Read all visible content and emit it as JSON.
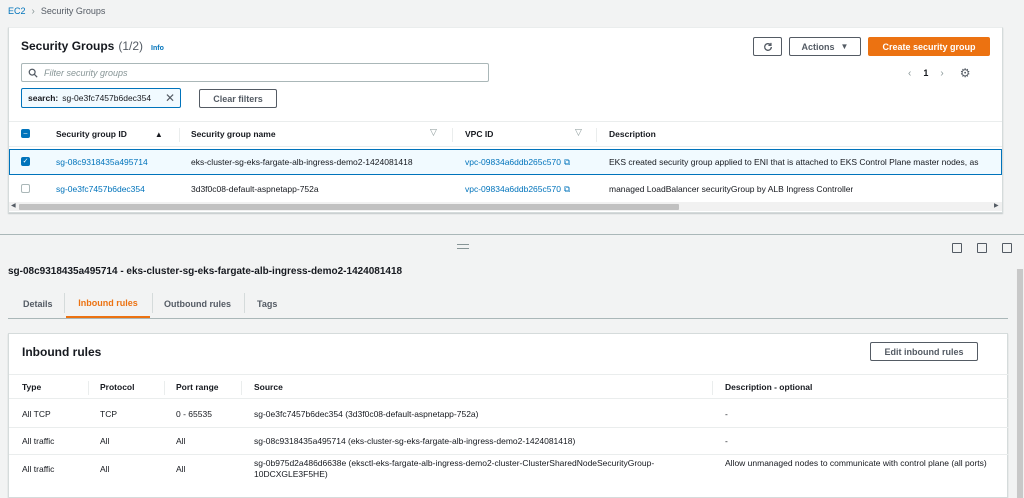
{
  "breadcrumb": {
    "root": "EC2",
    "current": "Security Groups"
  },
  "list": {
    "title": "Security Groups",
    "count": "(1/2)",
    "info": "Info",
    "refresh_icon": "refresh-icon",
    "actions_label": "Actions",
    "create_label": "Create security group",
    "search_placeholder": "Filter security groups",
    "token_key": "search:",
    "token_value": "sg-0e3fc7457b6dec354",
    "clear_label": "Clear filters",
    "page_number": "1",
    "columns": {
      "id": "Security group ID",
      "name": "Security group name",
      "vpc": "VPC ID",
      "desc": "Description"
    },
    "rows": [
      {
        "id": "sg-08c9318435a495714",
        "name": "eks-cluster-sg-eks-fargate-alb-ingress-demo2-1424081418",
        "vpc": "vpc-09834a6ddb265c570",
        "desc": "EKS created security group applied to ENI that is attached to EKS Control Plane master nodes, as",
        "selected": true
      },
      {
        "id": "sg-0e3fc7457b6dec354",
        "name": "3d3f0c08-default-aspnetapp-752a",
        "vpc": "vpc-09834a6ddb265c570",
        "desc": "managed LoadBalancer securityGroup by ALB Ingress Controller",
        "selected": false
      }
    ]
  },
  "detail": {
    "title": "sg-08c9318435a495714 - eks-cluster-sg-eks-fargate-alb-ingress-demo2-1424081418",
    "tabs": [
      "Details",
      "Inbound rules",
      "Outbound rules",
      "Tags"
    ],
    "active_tab": "Inbound rules",
    "inbound": {
      "title": "Inbound rules",
      "edit_label": "Edit inbound rules",
      "columns": {
        "type": "Type",
        "protocol": "Protocol",
        "port": "Port range",
        "source": "Source",
        "desc": "Description - optional"
      },
      "rows": [
        {
          "type": "All TCP",
          "protocol": "TCP",
          "port": "0 - 65535",
          "source": "sg-0e3fc7457b6dec354 (3d3f0c08-default-aspnetapp-752a)",
          "desc": "-"
        },
        {
          "type": "All traffic",
          "protocol": "All",
          "port": "All",
          "source": "sg-08c9318435a495714 (eks-cluster-sg-eks-fargate-alb-ingress-demo2-1424081418)",
          "desc": "-"
        },
        {
          "type": "All traffic",
          "protocol": "All",
          "port": "All",
          "source": "sg-0b975d2a486d6638e (eksctl-eks-fargate-alb-ingress-demo2-cluster-ClusterSharedNodeSecurityGroup-10DCXGLE3F5HE)",
          "desc": "Allow unmanaged nodes to communicate with control plane (all ports)"
        }
      ]
    }
  },
  "colors": {
    "link": "#0073bb",
    "accent": "#ec7211",
    "selected_bg": "#f1faff"
  }
}
